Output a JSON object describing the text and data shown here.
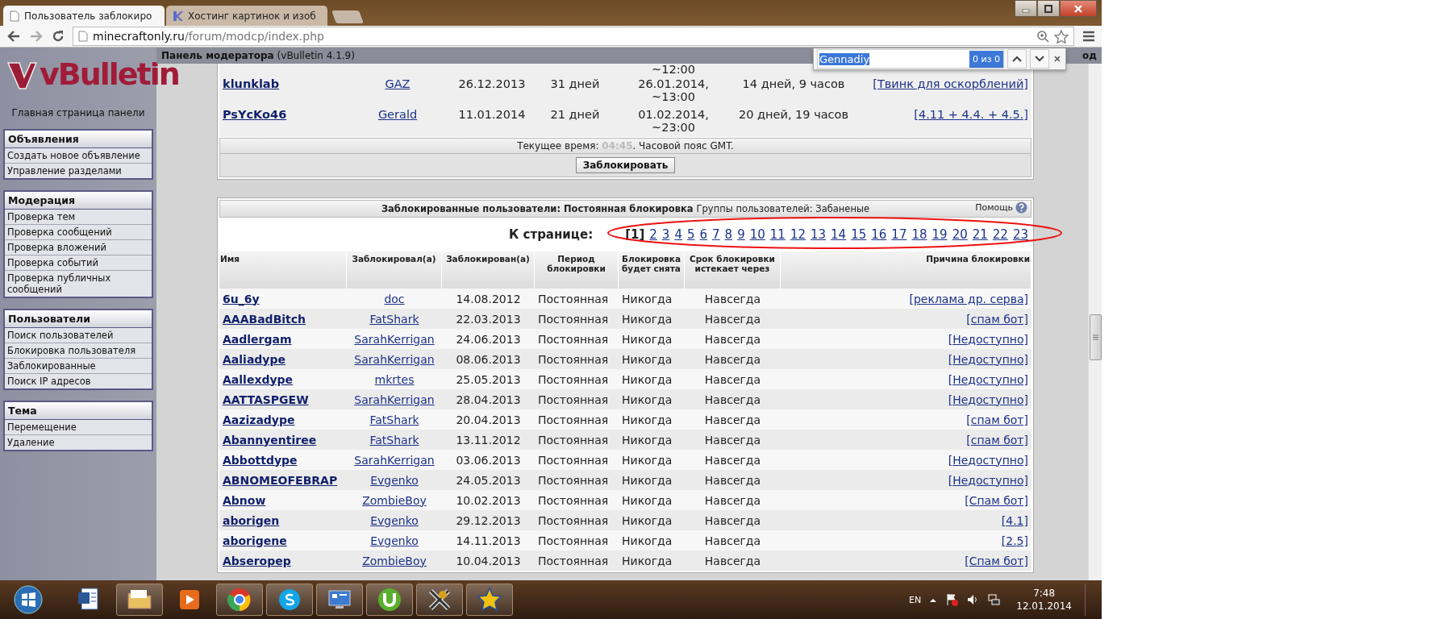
{
  "browser": {
    "tabs": [
      {
        "title": "Пользователь заблокиро",
        "selected": true
      },
      {
        "title": "Хостинг картинок и изоб",
        "selected": false
      }
    ],
    "url_host": "minecraftonly.ru",
    "url_path": "/forum/modcp/index.php"
  },
  "find_bar": {
    "value": "Gennadiy",
    "count": "0 из 0"
  },
  "header": {
    "title": "Панель модератора",
    "version": "(vBulletin 4.1.9)",
    "right_text": "од"
  },
  "sidebar": {
    "logo": "vBulletin",
    "home_link": "Главная страница панели",
    "groups": [
      {
        "title": "Объявления",
        "items": [
          "Создать новое объявление",
          "Управление разделами"
        ]
      },
      {
        "title": "Модерация",
        "items": [
          "Проверка тем",
          "Проверка сообщений",
          "Проверка вложений",
          "Проверка событий",
          "Проверка публичных сообщений"
        ]
      },
      {
        "title": "Пользователи",
        "items": [
          "Поиск пользователей",
          "Блокировка пользователя",
          "Заблокированные",
          "Поиск IP адресов"
        ]
      },
      {
        "title": "Тема",
        "items": [
          "Перемещение",
          "Удаление"
        ]
      }
    ]
  },
  "active_bans": {
    "rows": [
      {
        "lifted": "~12:00"
      },
      {
        "username": "klunklab",
        "by": "GAZ",
        "date": "26.12.2013",
        "period": "31 дней",
        "lifted": "26.01.2014, ~13:00",
        "remaining": "14 дней, 9 часов",
        "reason": "[Твинк для оскорблений]"
      },
      {
        "username": "PsYcKo46",
        "by": "Gerald",
        "date": "11.01.2014",
        "period": "21 дней",
        "lifted": "01.02.2014, ~23:00",
        "remaining": "20 дней, 19 часов",
        "reason": "[4.11 + 4.4. + 4.5.]"
      }
    ],
    "clock_label": "Текущее время: ",
    "clock_time": "04:45",
    "clock_suffix": ". Часовой пояс GMT.",
    "button": "Заблокировать"
  },
  "permanent_bans": {
    "title": "Заблокированные пользователи: Постоянная блокировка",
    "subtitle": "Группы пользователей: Забаненые",
    "help": "Помощь",
    "pages_label": "К странице:",
    "pages": [
      {
        "label": "[1]",
        "selected": true
      },
      {
        "label": "2",
        "selected": false
      },
      {
        "label": "3",
        "selected": false
      },
      {
        "label": "4",
        "selected": false
      },
      {
        "label": "5",
        "selected": false
      },
      {
        "label": "6",
        "selected": false
      },
      {
        "label": "7",
        "selected": false
      },
      {
        "label": "8",
        "selected": false
      },
      {
        "label": "9",
        "selected": false
      },
      {
        "label": "10",
        "selected": false
      },
      {
        "label": "11",
        "selected": false
      },
      {
        "label": "12",
        "selected": false
      },
      {
        "label": "13",
        "selected": false
      },
      {
        "label": "14",
        "selected": false
      },
      {
        "label": "15",
        "selected": false
      },
      {
        "label": "16",
        "selected": false
      },
      {
        "label": "17",
        "selected": false
      },
      {
        "label": "18",
        "selected": false
      },
      {
        "label": "19",
        "selected": false
      },
      {
        "label": "20",
        "selected": false
      },
      {
        "label": "21",
        "selected": false
      },
      {
        "label": "22",
        "selected": false
      },
      {
        "label": "23",
        "selected": false
      }
    ],
    "columns": [
      "Имя",
      "Заблокировал(а)",
      "Заблокирован(а)",
      "Период блокировки",
      "Блокировка будет снята",
      "Срок блокировки истекает через",
      "Причина блокировки"
    ],
    "rows": [
      {
        "username": "6u_6y",
        "by": "doc",
        "date": "14.08.2012",
        "period": "Постоянная",
        "lifted": "Никогда",
        "remaining": "Навсегда",
        "reason": "[реклама др. серва]"
      },
      {
        "username": "AAABadBitch",
        "by": "FatShark",
        "date": "22.03.2013",
        "period": "Постоянная",
        "lifted": "Никогда",
        "remaining": "Навсегда",
        "reason": "[спам бот]"
      },
      {
        "username": "Aadlergam",
        "by": "SarahKerrigan",
        "date": "24.06.2013",
        "period": "Постоянная",
        "lifted": "Никогда",
        "remaining": "Навсегда",
        "reason": "[Недоступно]"
      },
      {
        "username": "Aaliadype",
        "by": "SarahKerrigan",
        "date": "08.06.2013",
        "period": "Постоянная",
        "lifted": "Никогда",
        "remaining": "Навсегда",
        "reason": "[Недоступно]"
      },
      {
        "username": "Aallexdype",
        "by": "mkrtes",
        "date": "25.05.2013",
        "period": "Постоянная",
        "lifted": "Никогда",
        "remaining": "Навсегда",
        "reason": "[Недоступно]"
      },
      {
        "username": "AATTASPGEW",
        "by": "SarahKerrigan",
        "date": "28.04.2013",
        "period": "Постоянная",
        "lifted": "Никогда",
        "remaining": "Навсегда",
        "reason": "[Недоступно]"
      },
      {
        "username": "Aazizadype",
        "by": "FatShark",
        "date": "20.04.2013",
        "period": "Постоянная",
        "lifted": "Никогда",
        "remaining": "Навсегда",
        "reason": "[спам бот]"
      },
      {
        "username": "Abannyentiree",
        "by": "FatShark",
        "date": "13.11.2012",
        "period": "Постоянная",
        "lifted": "Никогда",
        "remaining": "Навсегда",
        "reason": "[спам бот]"
      },
      {
        "username": "Abbottdype",
        "by": "SarahKerrigan",
        "date": "03.06.2013",
        "period": "Постоянная",
        "lifted": "Никогда",
        "remaining": "Навсегда",
        "reason": "[Недоступно]"
      },
      {
        "username": "ABNOMEOFEBRAP",
        "by": "Evgenko",
        "date": "24.05.2013",
        "period": "Постоянная",
        "lifted": "Никогда",
        "remaining": "Навсегда",
        "reason": "[Недоступно]"
      },
      {
        "username": "Abnow",
        "by": "ZombieBoy",
        "date": "10.02.2013",
        "period": "Постоянная",
        "lifted": "Никогда",
        "remaining": "Навсегда",
        "reason": "[Спам бот]"
      },
      {
        "username": "aborigen",
        "by": "Evgenko",
        "date": "29.12.2013",
        "period": "Постоянная",
        "lifted": "Никогда",
        "remaining": "Навсегда",
        "reason": "[4.1]"
      },
      {
        "username": "aborigene",
        "by": "Evgenko",
        "date": "14.11.2013",
        "period": "Постоянная",
        "lifted": "Никогда",
        "remaining": "Навсегда",
        "reason": "[2.5]"
      },
      {
        "username": "Abseropep",
        "by": "ZombieBoy",
        "date": "10.04.2013",
        "period": "Постоянная",
        "lifted": "Никогда",
        "remaining": "Навсегда",
        "reason": "[Спам бот]"
      }
    ]
  },
  "taskbar": {
    "apps": [
      {
        "kind": "document",
        "running": false
      },
      {
        "kind": "folder",
        "running": true
      },
      {
        "kind": "player",
        "running": false
      },
      {
        "kind": "browser",
        "running": true
      },
      {
        "kind": "chat",
        "running": true
      },
      {
        "kind": "monitor",
        "running": true
      },
      {
        "kind": "torrent",
        "running": true
      },
      {
        "kind": "cross",
        "running": true
      },
      {
        "kind": "star",
        "running": true
      }
    ],
    "language": "EN",
    "time": "7:48",
    "date": "12.01.2014"
  }
}
